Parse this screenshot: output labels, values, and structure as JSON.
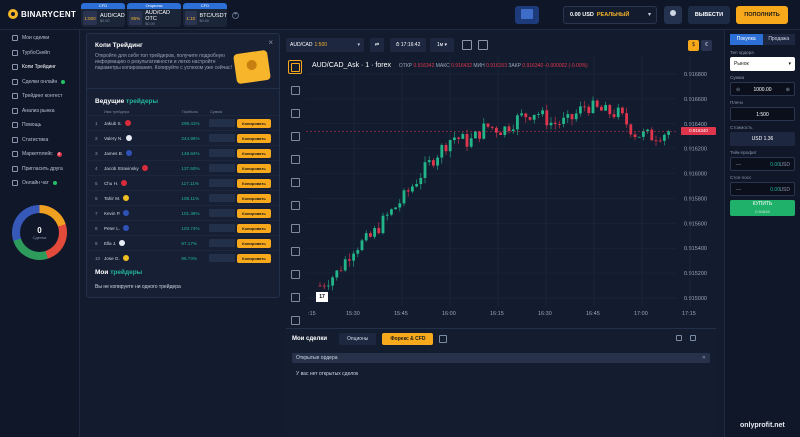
{
  "brand": {
    "name": "BINARYCENT"
  },
  "assets": [
    {
      "badge": "CFD",
      "pct": "1:500",
      "name": "AUD/CAD",
      "sub": "$0.00"
    },
    {
      "badge": "Опционы",
      "pct": "95%",
      "name": "AUD/CAD OTC",
      "sub": "$0.00"
    },
    {
      "badge": "CFD",
      "pct": "1:10",
      "name": "BTC/USDT",
      "sub": "$0.00"
    }
  ],
  "header": {
    "balance_amount": "0.00 USD",
    "balance_type": "РЕАЛЬНЫЙ",
    "withdraw": "ВЫВЕСТИ",
    "deposit": "ПОПОЛНИТЬ"
  },
  "sidebar": {
    "items": [
      {
        "label": "Мои сделки",
        "icon": "briefcase-icon"
      },
      {
        "label": "ТурбоСкейп",
        "icon": "turbo-icon"
      },
      {
        "label": "Копи Трейдинг",
        "icon": "copy-icon"
      },
      {
        "label": "Сделки онлайн",
        "icon": "live-icon"
      },
      {
        "label": "Трейдинг контест",
        "icon": "trophy-icon"
      },
      {
        "label": "Анализ рынка",
        "icon": "analysis-icon"
      },
      {
        "label": "Помощь",
        "icon": "help-icon"
      },
      {
        "label": "Статистика",
        "icon": "stats-icon"
      },
      {
        "label": "Маркетплейс",
        "icon": "market-icon"
      },
      {
        "label": "Пригласить друга",
        "icon": "invite-icon"
      },
      {
        "label": "Онлайн чат",
        "icon": "chat-icon"
      }
    ],
    "marketplace_badge": "8",
    "donut_count": "0",
    "donut_label": "Сделки"
  },
  "copy_panel": {
    "title": "Копи Трейдинг",
    "description": "Откройте для себя топ трейдеров, получите подробную информацию о результативности и легко настройте параметры копирования. Копируйте с успехом уже сейчас!",
    "leaders_title": "Ведущие",
    "leaders_highlight": "трейдеры",
    "columns": {
      "name": "Имя трейдера",
      "profit": "Прибыль",
      "sum": "Сумма"
    },
    "copy_label": "Копировать",
    "traders": [
      {
        "num": "1",
        "name": "Jakub S.",
        "profit": "299.41%",
        "flag_color": "#d92b3a"
      },
      {
        "num": "2",
        "name": "Valery N.",
        "profit": "244.96%",
        "flag_color": "#e8ecf4"
      },
      {
        "num": "3",
        "name": "James B.",
        "profit": "148.84%",
        "flag_color": "#2d53b8"
      },
      {
        "num": "4",
        "name": "Jacob Stravinsky",
        "profit": "137.50%",
        "flag_color": "#d92b3a"
      },
      {
        "num": "5",
        "name": "Chu H.",
        "profit": "117.11%",
        "flag_color": "#d92b3a"
      },
      {
        "num": "6",
        "name": "Tahir M.",
        "profit": "108.11%",
        "flag_color": "#f0c020"
      },
      {
        "num": "7",
        "name": "Kevin P.",
        "profit": "101.36%",
        "flag_color": "#2d53b8"
      },
      {
        "num": "8",
        "name": "Peter L.",
        "profit": "103.74%",
        "flag_color": "#2d53b8"
      },
      {
        "num": "9",
        "name": "Ella J.",
        "profit": "97.17%",
        "flag_color": "#e8ecf4"
      },
      {
        "num": "10",
        "name": "Jose G.",
        "profit": "96.73%",
        "flag_color": "#f0c020"
      }
    ],
    "my_title": "Мои",
    "my_highlight": "трейдеры",
    "my_empty": "Вы не копируете ни одного трейдера"
  },
  "chart_toolbar": {
    "symbol": "AUD/CAD",
    "leverage": "1:500",
    "time": "17:16:42",
    "timeframe": "1м",
    "currency_a": "$",
    "currency_b": "€"
  },
  "chart_header": {
    "title": "AUD/CAD_Ask · 1 · forex",
    "open_label": "ОТКР",
    "open": "0.916342",
    "high_label": "МАКС",
    "high": "0.916432",
    "low_label": "МИН",
    "low": "0.916153",
    "close_label": "ЗАКР",
    "close": "0.916340",
    "change": "-0.000002 (-0.00%)"
  },
  "chart_data": {
    "type": "candlestick",
    "x_ticks": [
      "15:30",
      "15:45",
      "16:00",
      "16:15",
      "16:30",
      "16:45",
      "17:00",
      "17:15"
    ],
    "x_edge_left": ":15",
    "y_ticks": [
      "0.916800",
      "0.916600",
      "0.916400",
      "0.916200",
      "0.916000",
      "0.915800",
      "0.915600",
      "0.915400",
      "0.915200",
      "0.915000"
    ],
    "ylim": [
      0.915,
      0.9168
    ],
    "last_price": "0.916340",
    "up_color": "#23b58a",
    "down_color": "#e0364d"
  },
  "orders": {
    "title": "Мои сделки",
    "tab_options": "Опционы",
    "tab_forex": "Форекс & CFD",
    "open_orders": "Открытые ордера",
    "empty": "У вас нет открытых сделок"
  },
  "trade_panel": {
    "tab_buy": "Покупка",
    "tab_sell": "Продажа",
    "order_type_label": "Тип ордера",
    "order_type": "Рынок",
    "amount_label": "Сумма",
    "amount": "1000.00",
    "leverage_label": "Плечо",
    "leverage": "1:500",
    "cost_label": "Стоимость",
    "cost": "USD 1.36",
    "tp_label": "Тейк-профит",
    "tp_value": "0.00",
    "sl_label": "Стоп-лосс",
    "sl_value": "0.00",
    "field_minus": "—",
    "currency": "USD",
    "buy_label": "КУПИТЬ",
    "buy_price": "0.91634"
  },
  "watermark": "onlyprofit.net"
}
